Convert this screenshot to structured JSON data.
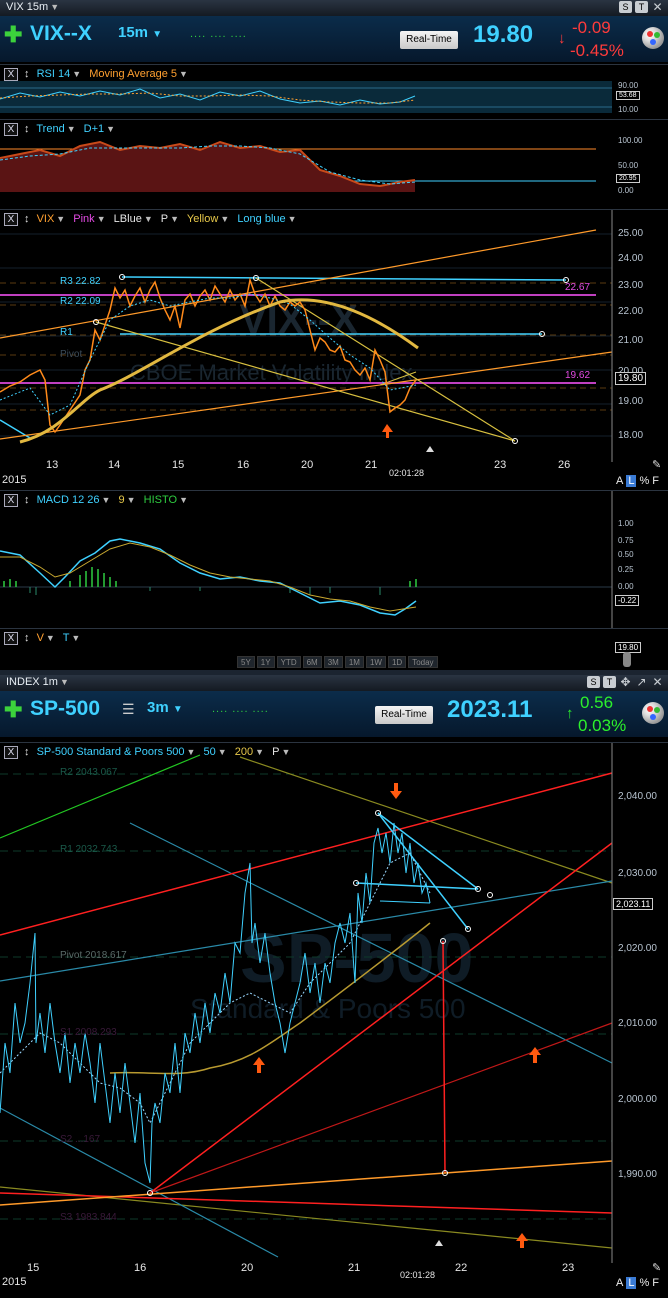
{
  "vix": {
    "window_title": "VIX 15m",
    "symbol": "VIX--X",
    "interval": "15m",
    "realtime_label": "Real-Time",
    "price": "19.80",
    "change": "-0.09",
    "change_pct": "-0.45%",
    "rsi": {
      "label": "RSI 14",
      "ma_label": "Moving Average 5",
      "ticks": [
        "90.00",
        "53.68",
        "10.00"
      ]
    },
    "trend": {
      "label": "Trend",
      "d1_label": "D+1",
      "ticks": [
        "100.00",
        "50.00",
        "20.95",
        "0.00"
      ]
    },
    "price_panel": {
      "legend": [
        "VIX",
        "Pink",
        "LBlue",
        "P",
        "Yellow",
        "Long blue"
      ],
      "ticks": [
        "25.00",
        "24.00",
        "23.00",
        "22.00",
        "21.00",
        "20.00",
        "19.00",
        "18.00"
      ],
      "last_price": "19.80",
      "levels": {
        "r3": "R3 22.82",
        "r2": "R2 22.09",
        "r1": "R1",
        "pivot": "Pivot",
        "pink_hi": "22.67",
        "pink_lo": "19.62"
      },
      "watermark_symbol": "VIX--X",
      "watermark_name": "CBOE Market Volatility Index",
      "x_labels": [
        "13",
        "14",
        "15",
        "16",
        "20",
        "21",
        "23",
        "26"
      ],
      "year": "2015",
      "clock": "02:01:28"
    },
    "macd": {
      "label": "MACD 12 26",
      "signal": "9",
      "histo": "HISTO",
      "ticks": [
        "1.00",
        "0.75",
        "0.50",
        "0.25",
        "0.00",
        "-0.22"
      ]
    },
    "volume": {
      "v": "V",
      "t": "T",
      "value": "19.80"
    },
    "ranges": [
      "5Y",
      "1Y",
      "YTD",
      "6M",
      "3M",
      "1M",
      "1W",
      "1D",
      "Today"
    ],
    "alf": [
      "A",
      "L",
      "%",
      "F"
    ]
  },
  "spx": {
    "window_title": "INDEX 1m",
    "symbol": "SP-500",
    "interval": "3m",
    "realtime_label": "Real-Time",
    "price": "2023.11",
    "change": "0.56",
    "change_pct": "0.03%",
    "legend": {
      "name": "SP-500 Standard & Poors 500",
      "ma50": "50",
      "ma200": "200",
      "p": "P"
    },
    "levels": {
      "r2": "R2 2043.067",
      "r1": "R1 2032.743",
      "pivot": "Pivot 2018.617",
      "s1": "S1 2008.293",
      "s2": "S2 ...167",
      "s3": "S3 1983.844"
    },
    "ticks": [
      "2,040.00",
      "2,030.00",
      "2,020.00",
      "2,010.00",
      "2,000.00",
      "1,990.00"
    ],
    "last_price": "2,023.11",
    "watermark_symbol": "SP-500",
    "watermark_name": "Standard & Poors 500",
    "x_labels": [
      "15",
      "16",
      "20",
      "21",
      "22",
      "23"
    ],
    "year": "2015",
    "clock": "02:01:28",
    "alf": [
      "A",
      "L",
      "%",
      "F"
    ]
  },
  "colors": {
    "cyan": "#3fd1ff",
    "orange": "#ffa030",
    "pink": "#e34be3",
    "red": "#ff2020",
    "yellow": "#e6c84a",
    "green": "#2ecc40"
  }
}
